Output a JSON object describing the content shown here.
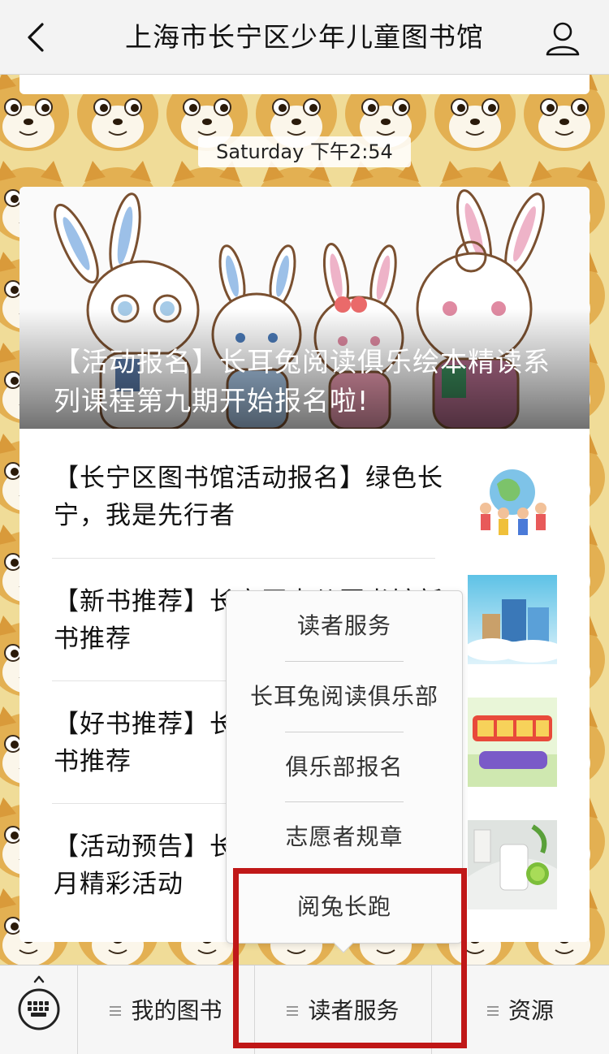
{
  "header": {
    "title": "上海市长宁区少年儿童图书馆",
    "back_icon": "chevron-left-icon",
    "profile_icon": "user-profile-icon"
  },
  "chat": {
    "timestamp": "Saturday 下午2:54"
  },
  "article": {
    "hero_title": "【活动报名】长耳兔阅读俱乐绘本精读系列课程第九期开始报名啦!",
    "items": [
      {
        "title": "【长宁区图书馆活动报名】绿色长宁，我是先行者",
        "thumb": "kids-globe-thumbnail"
      },
      {
        "title": "【新书推荐】长宁区少儿图书馆新书推荐",
        "thumb": "books-clouds-thumbnail"
      },
      {
        "title": "【好书推荐】长宁区少儿图书馆好书推荐",
        "thumb": "good-book-banner-thumbnail"
      },
      {
        "title": "【活动预告】长宁区少儿图书馆6月精彩活动",
        "thumb": "summer-drink-thumbnail"
      }
    ]
  },
  "popup_menu": {
    "items": [
      {
        "label": "读者服务"
      },
      {
        "label": "长耳兔阅读俱乐部"
      },
      {
        "label": "俱乐部报名"
      },
      {
        "label": "志愿者规章"
      },
      {
        "label": "阅兔长跑"
      }
    ]
  },
  "bottom_menu": {
    "keyboard_icon": "keyboard-icon",
    "items": [
      {
        "label": "我的图书"
      },
      {
        "label": "读者服务"
      },
      {
        "label": "资源"
      }
    ]
  },
  "colors": {
    "highlight": "#c01818",
    "navbar_bg": "#f3f3f3",
    "chat_bg": "#f1e3a6"
  }
}
